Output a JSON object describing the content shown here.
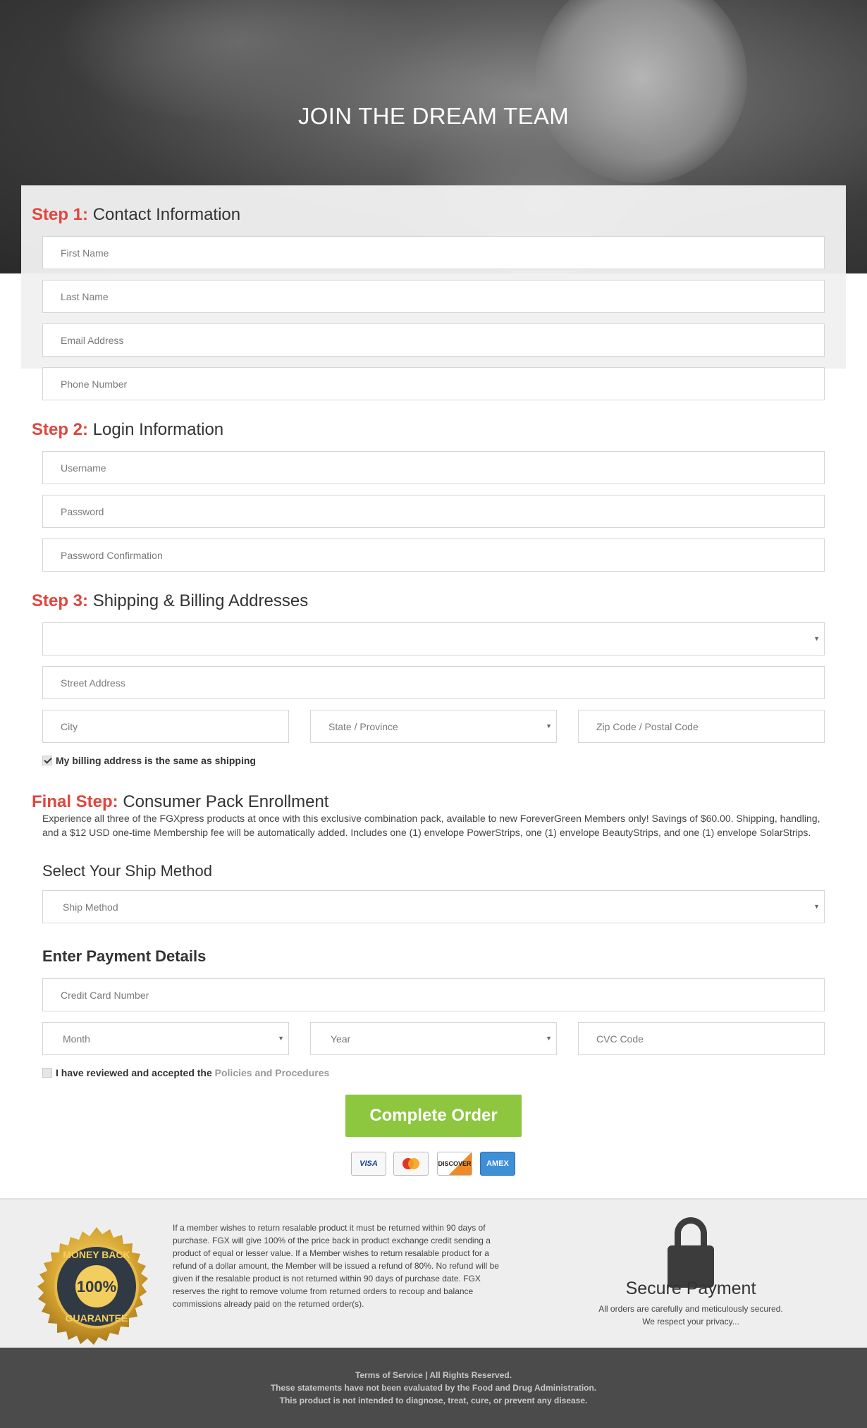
{
  "hero": {
    "title": "JOIN THE DREAM TEAM"
  },
  "step1": {
    "prefix": "Step 1:",
    "title": "Contact Information",
    "fields": {
      "first_name": "First Name",
      "last_name": "Last Name",
      "email": "Email Address",
      "phone": "Phone Number"
    }
  },
  "step2": {
    "prefix": "Step 2:",
    "title": "Login Information",
    "fields": {
      "username": "Username",
      "password": "Password",
      "password_confirmation": "Password Confirmation"
    }
  },
  "step3": {
    "prefix": "Step 3:",
    "title": "Shipping & Billing Addresses",
    "fields": {
      "country": "",
      "street": "Street Address",
      "city": "City",
      "state": "State / Province",
      "zip": "Zip Code / Postal Code"
    },
    "billing_same": "My billing address is the same as shipping",
    "billing_same_checked": true
  },
  "final_step": {
    "prefix": "Final Step:",
    "title": "Consumer Pack Enrollment",
    "description": "Experience all three of the FGXpress products at once with this exclusive combination pack, available to new ForeverGreen Members only! Savings of $60.00. Shipping, handling, and a $12 USD one-time Membership fee will be automatically added. Includes one (1) envelope PowerStrips, one (1) envelope BeautyStrips, and one (1) envelope SolarStrips."
  },
  "ship": {
    "heading": "Select Your Ship Method",
    "method": "Ship Method"
  },
  "payment": {
    "heading": "Enter Payment Details",
    "card_number": "Credit Card Number",
    "month": "Month",
    "year": "Year",
    "cvc": "CVC Code"
  },
  "agreement": {
    "text": "I have reviewed and accepted the ",
    "link": "Policies and Procedures",
    "checked": false
  },
  "order_button": "Complete Order",
  "card_logos": [
    "VISA",
    "MasterCard",
    "DISCOVER",
    "AMEX"
  ],
  "guarantee": {
    "badge_top": "MONEY BACK",
    "badge_center": "100%",
    "badge_bottom": "GUARANTEE",
    "text": "If a member wishes to return resalable product it must be returned within 90 days of purchase. FGX will give 100% of the price back in product exchange credit sending a product of equal or lesser value. If a Member wishes to return resalable product for a refund of a dollar amount, the Member will be issued a refund of 80%. No refund will be given if the resalable product is not returned within 90 days of purchase date. FGX reserves the right to remove volume from returned orders to recoup and balance commissions already paid on the returned order(s)."
  },
  "secure": {
    "title": "Secure Payment",
    "line1": "All orders are carefully and meticulously secured.",
    "line2": "We respect your privacy..."
  },
  "footer": {
    "line1": "Terms of Service | All Rights Reserved.",
    "line2": "These statements have not been evaluated by the Food and Drug Administration.",
    "line3": "This product is not intended to diagnose, treat, cure, or prevent any disease."
  },
  "colors": {
    "accent_red": "#e0463e",
    "button_green": "#8dc63f",
    "footer_bg": "#4b4b4b"
  }
}
